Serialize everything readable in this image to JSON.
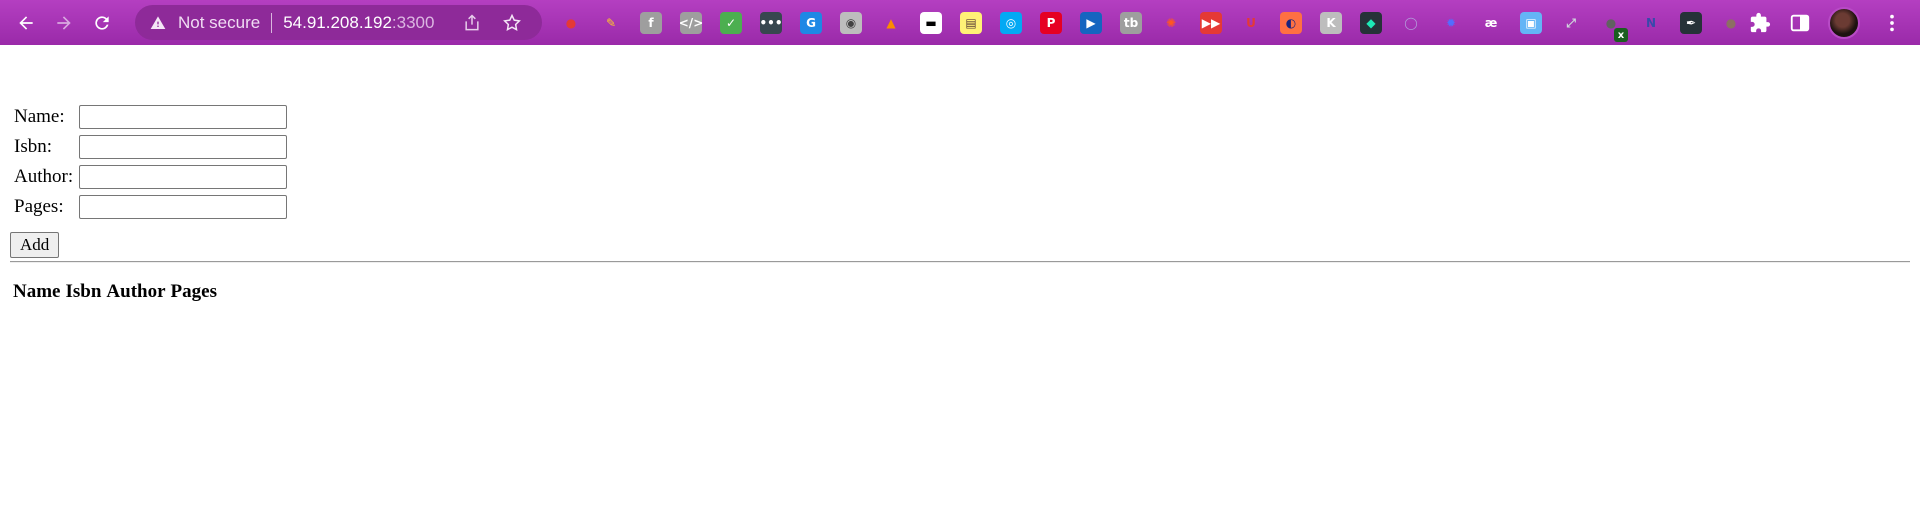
{
  "browser": {
    "security_label": "Not secure",
    "url_host": "54.91.208.192",
    "url_port": ":3300",
    "toolbar_color": "#a535b4",
    "extension_badge": "x",
    "extensions": [
      {
        "name": "extension-tomato-icon",
        "glyph": "●",
        "bg": "transparent",
        "color": "#e53935"
      },
      {
        "name": "extension-brush-icon",
        "glyph": "✎",
        "bg": "transparent",
        "color": "#ffca28"
      },
      {
        "name": "extension-facebook-icon",
        "glyph": "f",
        "bg": "#9e9e9e",
        "color": "#ffffff"
      },
      {
        "name": "extension-code-icon",
        "glyph": "</>",
        "bg": "#9e9e9e",
        "color": "#ffffff"
      },
      {
        "name": "extension-mail-check-icon",
        "glyph": "✓",
        "bg": "#4caf50",
        "color": "#ffffff"
      },
      {
        "name": "extension-dots-icon",
        "glyph": "•••",
        "bg": "#37474f",
        "color": "#ffffff"
      },
      {
        "name": "extension-translate-icon",
        "glyph": "G",
        "bg": "#1e88e5",
        "color": "#ffffff"
      },
      {
        "name": "extension-camera-icon",
        "glyph": "◉",
        "bg": "#bdbdbd",
        "color": "#424242"
      },
      {
        "name": "extension-fox-icon",
        "glyph": "▲",
        "bg": "transparent",
        "color": "#fb8c00"
      },
      {
        "name": "extension-mask-icon",
        "glyph": "▬",
        "bg": "#ffffff",
        "color": "#000000"
      },
      {
        "name": "extension-note-icon",
        "glyph": "▤",
        "bg": "#fff176",
        "color": "#5d4037"
      },
      {
        "name": "extension-eye-icon",
        "glyph": "◎",
        "bg": "#03a9f4",
        "color": "#ffffff"
      },
      {
        "name": "extension-pinterest-icon",
        "glyph": "P",
        "bg": "#e60023",
        "color": "#ffffff"
      },
      {
        "name": "extension-play-icon",
        "glyph": "▶",
        "bg": "#1565c0",
        "color": "#ffffff"
      },
      {
        "name": "extension-tb-icon",
        "glyph": "tb",
        "bg": "#9e9e9e",
        "color": "#ffffff"
      },
      {
        "name": "extension-color-wheel-icon",
        "glyph": "✺",
        "bg": "transparent",
        "color": "#ff5722"
      },
      {
        "name": "extension-video-icon",
        "glyph": "▶▶",
        "bg": "#e53935",
        "color": "#ffffff"
      },
      {
        "name": "extension-u-icon",
        "glyph": "U",
        "bg": "transparent",
        "color": "#e53935"
      },
      {
        "name": "extension-swirl-icon",
        "glyph": "◐",
        "bg": "#ff7043",
        "color": "#1a237e"
      },
      {
        "name": "extension-k-icon",
        "glyph": "K",
        "bg": "#bdbdbd",
        "color": "#ffffff"
      },
      {
        "name": "extension-diamond-icon",
        "glyph": "◆",
        "bg": "#263238",
        "color": "#1de9b6"
      },
      {
        "name": "extension-chat-icon",
        "glyph": "◯",
        "bg": "transparent",
        "color": "#b39ddb"
      },
      {
        "name": "extension-gear-icon",
        "glyph": "✹",
        "bg": "transparent",
        "color": "#536dfe"
      },
      {
        "name": "extension-ae-icon",
        "glyph": "æ",
        "bg": "transparent",
        "color": "#ffffff"
      },
      {
        "name": "extension-puzzle-blue-icon",
        "glyph": "▣",
        "bg": "#64b5f6",
        "color": "#ffffff"
      },
      {
        "name": "extension-expand-icon",
        "glyph": "⤢",
        "bg": "transparent",
        "color": "#cfd8dc"
      },
      {
        "name": "extension-spy-icon",
        "glyph": "●",
        "bg": "transparent",
        "color": "#616161"
      },
      {
        "name": "extension-n-icon",
        "glyph": "N",
        "bg": "transparent",
        "color": "#3949ab"
      },
      {
        "name": "extension-feather-icon",
        "glyph": "✒",
        "bg": "#263238",
        "color": "#ffffff"
      },
      {
        "name": "extension-cookie-icon",
        "glyph": "●",
        "bg": "transparent",
        "color": "#8d6e63"
      }
    ]
  },
  "form": {
    "fields": [
      {
        "label": "Name:",
        "value": "",
        "placeholder": ""
      },
      {
        "label": "Isbn:",
        "value": "",
        "placeholder": ""
      },
      {
        "label": "Author:",
        "value": "",
        "placeholder": ""
      },
      {
        "label": "Pages:",
        "value": "",
        "placeholder": ""
      }
    ],
    "submit_label": "Add"
  },
  "book_list": {
    "columns": [
      "Name",
      "Isbn",
      "Author",
      "Pages"
    ],
    "rows": []
  }
}
